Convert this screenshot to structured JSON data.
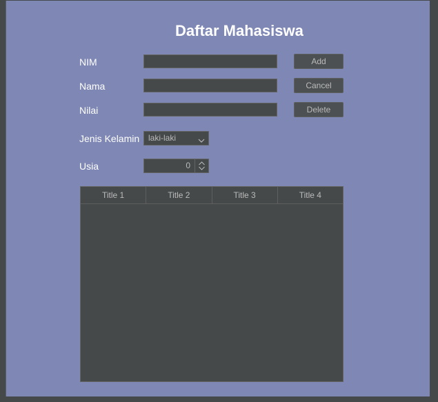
{
  "window": {
    "title": "Daftar Mahasiswa"
  },
  "form": {
    "nim_label": "NIM",
    "nama_label": "Nama",
    "nilai_label": "Nilai",
    "nim_value": "",
    "nama_value": "",
    "nilai_value": "",
    "jenis_kelamin_label": "Jenis Kelamin",
    "jenis_kelamin_selected": "laki-laki",
    "usia_label": "Usia",
    "usia_value": "0"
  },
  "buttons": {
    "add": "Add",
    "cancel": "Cancel",
    "delete": "Delete"
  },
  "table": {
    "columns": [
      "Title 1",
      "Title 2",
      "Title 3",
      "Title 4"
    ],
    "rows": []
  },
  "colors": {
    "panel_background": "#7f88b5",
    "control_background": "#45494a",
    "control_text": "#bbbbbb",
    "label_text": "#ffffff"
  },
  "icons": {
    "combo_arrow": "chevron-down-icon",
    "spinner": "spinner-up-down-icon"
  }
}
